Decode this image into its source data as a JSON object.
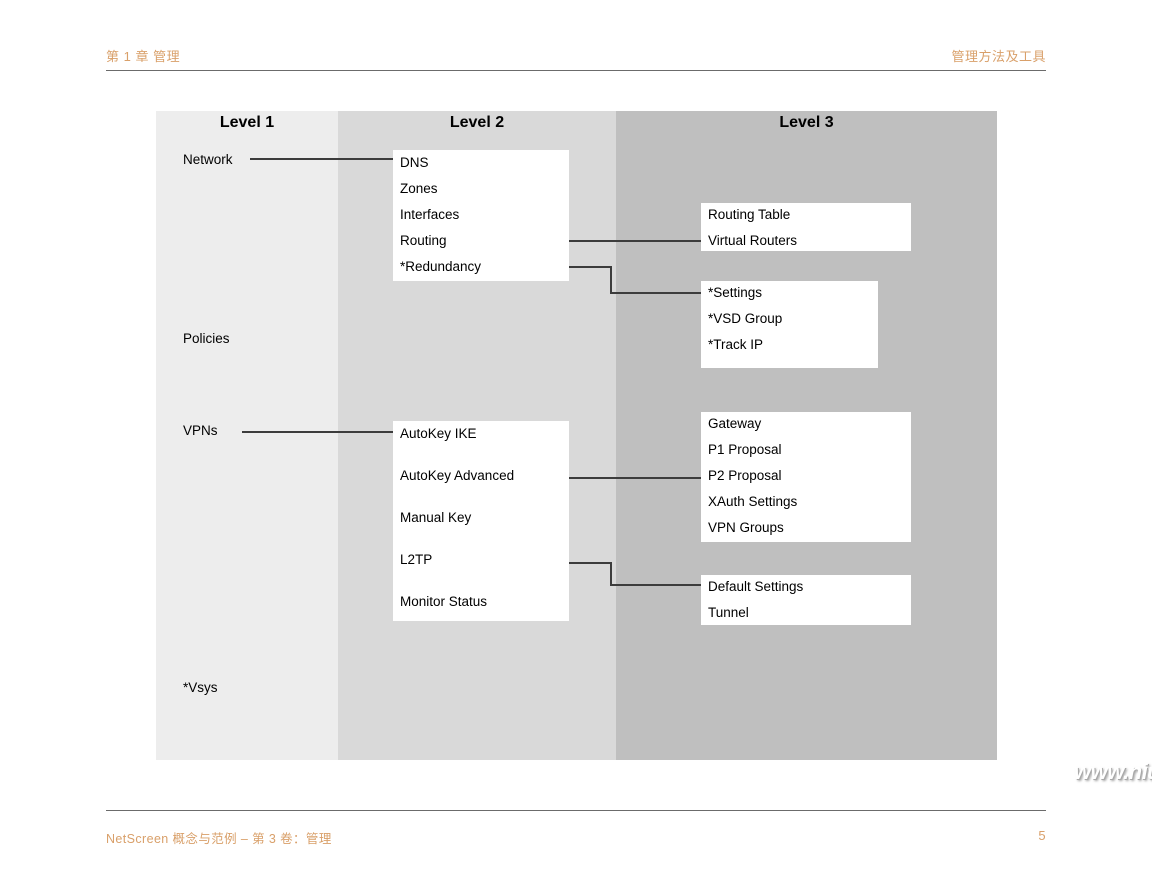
{
  "header": {
    "left": "第 1 章 管理",
    "right": "管理方法及工具"
  },
  "footer": {
    "left": "NetScreen 概念与范例 – 第 3 卷：管理",
    "page_number": "5"
  },
  "watermark": "www.niubb.net",
  "diagram": {
    "columns": [
      {
        "title": "Level 1",
        "bg": "#ededed"
      },
      {
        "title": "Level 2",
        "bg": "#d9d9d9"
      },
      {
        "title": "Level 3",
        "bg": "#bfbfbf"
      }
    ],
    "level1_labels": [
      {
        "label": "Network"
      },
      {
        "label": "Policies"
      },
      {
        "label": "VPNs"
      },
      {
        "label": "*Vsys"
      }
    ],
    "level2_boxes": [
      {
        "name": "network-menu",
        "items": [
          "DNS",
          "Zones",
          "Interfaces",
          "Routing",
          "*Redundancy"
        ]
      },
      {
        "name": "vpns-menu",
        "items": [
          "AutoKey IKE",
          "AutoKey Advanced",
          "Manual Key",
          "L2TP",
          "Monitor Status"
        ]
      }
    ],
    "level3_boxes": [
      {
        "name": "routing-submenu",
        "items": [
          "Routing Table",
          "Virtual Routers"
        ]
      },
      {
        "name": "redundancy-submenu",
        "items": [
          "*Settings",
          "*VSD Group",
          "*Track IP"
        ]
      },
      {
        "name": "autokey-advanced-submenu",
        "items": [
          "Gateway",
          "P1 Proposal",
          "P2 Proposal",
          "XAuth Settings",
          "VPN Groups"
        ]
      },
      {
        "name": "l2tp-submenu",
        "items": [
          "Default Settings",
          "Tunnel"
        ]
      }
    ]
  }
}
